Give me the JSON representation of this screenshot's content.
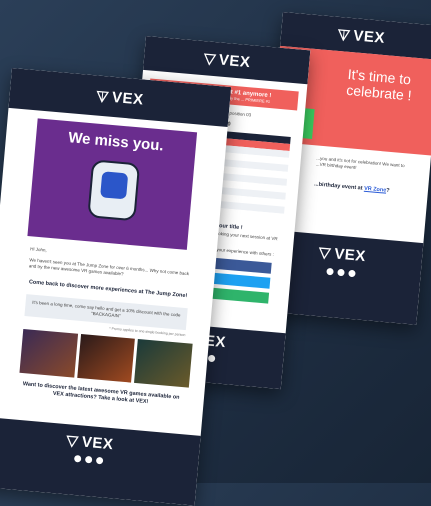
{
  "brand": "VEX",
  "back": {
    "headline": "It's time to celebrate !",
    "line1": "...you and it's not for celebration! We want to",
    "line2": "...VR birthday event!",
    "cta_prefix": "...birthday event at ",
    "cta_link": "VR Zone",
    "cta_suffix": "?"
  },
  "middle": {
    "alert_title": "Oh no... You are not #1 anymore !",
    "alert_sub": "... been taken away from you by the ... PRIMIERE #1",
    "intro": "...now standing at position 03",
    "leaderboard_title": "TOP 10",
    "rows": [
      "",
      "",
      "",
      "",
      "",
      "",
      "",
      "",
      "",
      ""
    ],
    "claim_title": "...claim back your title !",
    "claim_text": "...back your title for another try by booking your next session at VR Zone!",
    "share_text": "...on any of the social media below your experience with others :",
    "buttons": [
      "Share on Facebook",
      "Share on Twitter",
      "Share on Instagram"
    ]
  },
  "front": {
    "hero_title": "We miss you.",
    "greeting": "Hi John,",
    "body": "We haven't seen you at The Jump Zone for over 6 months... Why not come back and try the new awesome VR games available?",
    "discover_title": "Come back to discover more experiences at The Jump Zone!",
    "promo": "It's been a long time, come say hello and get a 10% discount with the code \"BACKAGAIN\"",
    "promo_note": "* Promo applies to one single booking per person",
    "footer_cta": "Want to discover the latest awesome VR games available on VEX attractions? Take a look at VEX!",
    "footer_link": "VEX"
  },
  "colors": {
    "navy": "#1b2338",
    "purple": "#6a2d8e",
    "coral": "#f0605c",
    "share_fb": "#3b5998",
    "share_tw": "#1da1f2",
    "share_ig": "#2fb46b"
  }
}
